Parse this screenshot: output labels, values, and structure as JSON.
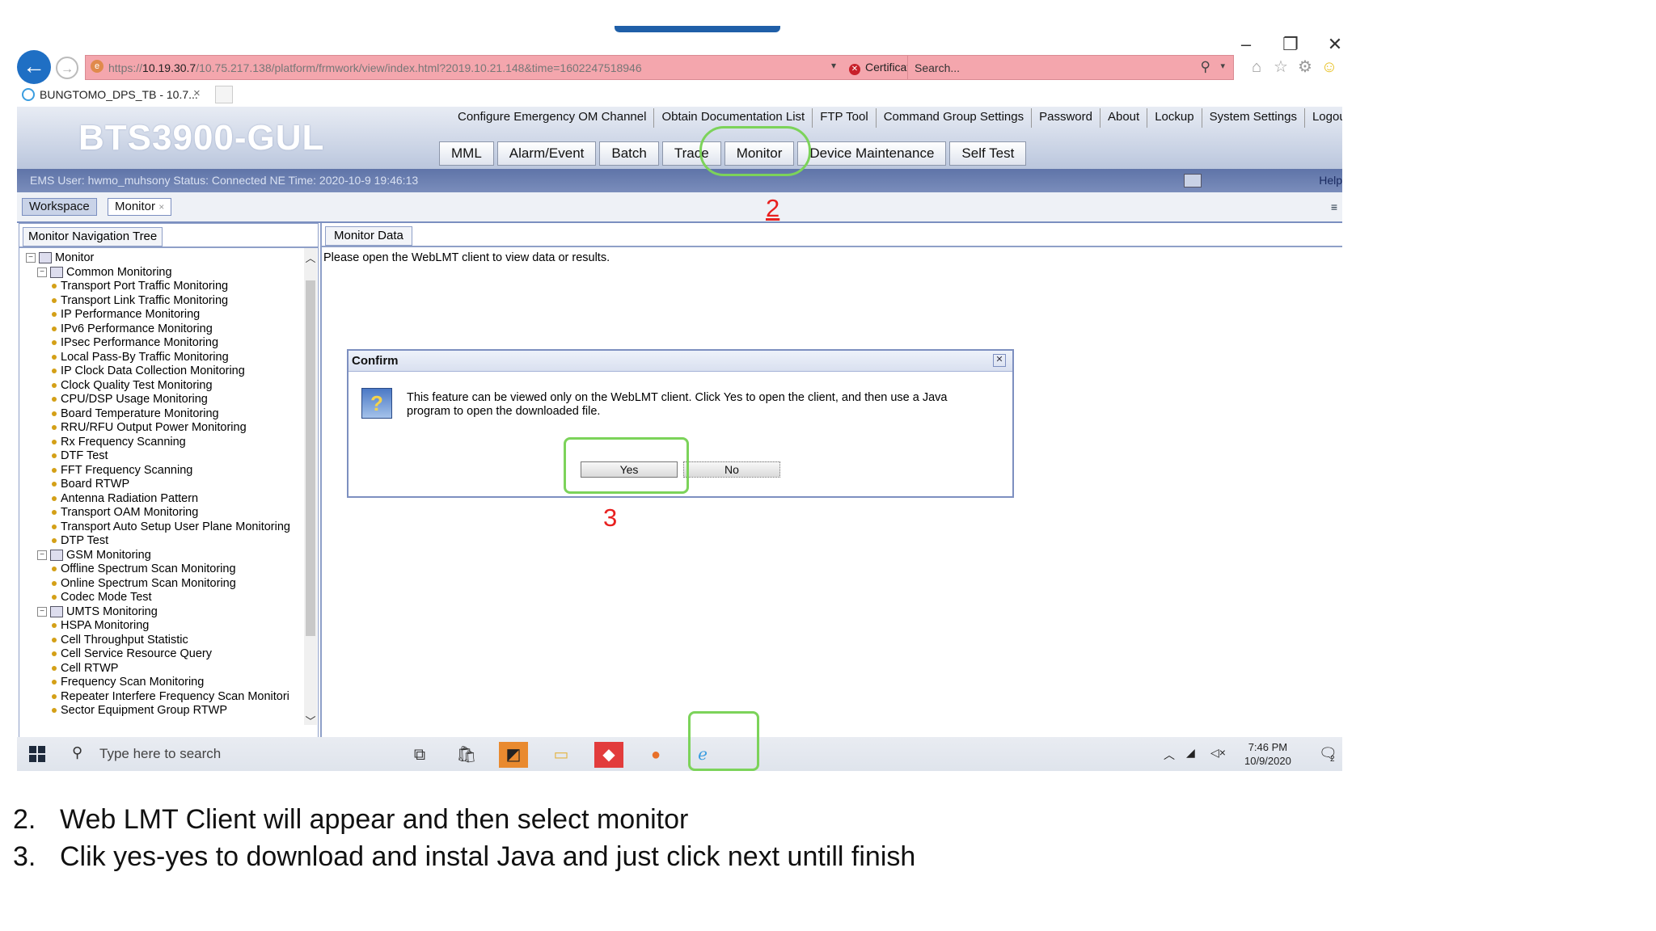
{
  "browser": {
    "url_prefix": "https://",
    "url_host": "10.19.30.7",
    "url_rest": "/10.75.217.138/platform/frmwork/view/index.html?2019.10.21.148&time=1602247518946",
    "certificate_error": "Certificate error",
    "search_placeholder": "Search...",
    "tab_title": "BUNGTOMO_DPS_TB - 10.7...",
    "tab_close": "×"
  },
  "app": {
    "title": "BTS3900-GUL",
    "top_menu": [
      "Configure Emergency OM Channel",
      "Obtain Documentation List",
      "FTP Tool",
      "Command Group Settings",
      "Password",
      "About",
      "Lockup",
      "System Settings",
      "Logout"
    ],
    "main_tabs": [
      "MML",
      "Alarm/Event",
      "Batch",
      "Trace",
      "Monitor",
      "Device Maintenance",
      "Self Test"
    ],
    "status_text": "EMS User: hwmo_muhsony   Status: Connected   NE Time: 2020-10-9 19:46:13",
    "help": "Help"
  },
  "workspace_tabs": {
    "workspace": "Workspace",
    "monitor": "Monitor",
    "monitor_close": "×"
  },
  "left_panel": {
    "tab": "Monitor Navigation Tree",
    "tree": {
      "root": "Monitor",
      "groups": [
        {
          "label": "Common Monitoring",
          "items": [
            "Transport Port Traffic Monitoring",
            "Transport Link Traffic Monitoring",
            "IP Performance Monitoring",
            "IPv6 Performance Monitoring",
            "IPsec Performance Monitoring",
            "Local Pass-By Traffic Monitoring",
            "IP Clock Data Collection Monitoring",
            "Clock Quality Test Monitoring",
            "CPU/DSP Usage Monitoring",
            "Board Temperature Monitoring",
            "RRU/RFU Output Power Monitoring",
            "Rx Frequency Scanning",
            "DTF Test",
            "FFT Frequency Scanning",
            "Board RTWP",
            "Antenna Radiation Pattern",
            "Transport OAM Monitoring",
            "Transport Auto Setup User Plane Monitoring",
            "DTP Test"
          ]
        },
        {
          "label": "GSM Monitoring",
          "items": [
            "Offline Spectrum Scan Monitoring",
            "Online Spectrum Scan Monitoring",
            "Codec Mode Test"
          ]
        },
        {
          "label": "UMTS Monitoring",
          "items": [
            "HSPA Monitoring",
            "Cell Throughput Statistic",
            "Cell Service Resource Query",
            "Cell RTWP",
            "Frequency Scan Monitoring",
            "Repeater Interfere Frequency Scan Monitori",
            "Sector Equipment Group RTWP"
          ]
        }
      ]
    }
  },
  "right_panel": {
    "tab": "Monitor Data",
    "message": "Please open the WebLMT client to view data or results."
  },
  "dialog": {
    "title": "Confirm",
    "message": "This feature can be viewed only on the WebLMT client. Click Yes to open the client, and then use a Java program to open the downloaded file.",
    "yes": "Yes",
    "no": "No"
  },
  "annotations": {
    "step2": "2",
    "step3": "3",
    "highlight_color": "#7cd35a",
    "number_color": "#e8201f"
  },
  "taskbar": {
    "search_placeholder": "Type here to search",
    "time": "7:46 PM",
    "date": "10/9/2020",
    "notification_count": "2",
    "apps": [
      "task-view-icon",
      "store-icon",
      "sticky-notes-icon",
      "file-explorer-icon",
      "anydesk-icon",
      "firefox-icon",
      "internet-explorer-icon"
    ]
  },
  "captions": [
    {
      "num": "2.",
      "text": "Web LMT Client  will appear and then select monitor"
    },
    {
      "num": "3.",
      "text": "Clik yes-yes to download  and instal Java and just click next  untill finish"
    }
  ]
}
